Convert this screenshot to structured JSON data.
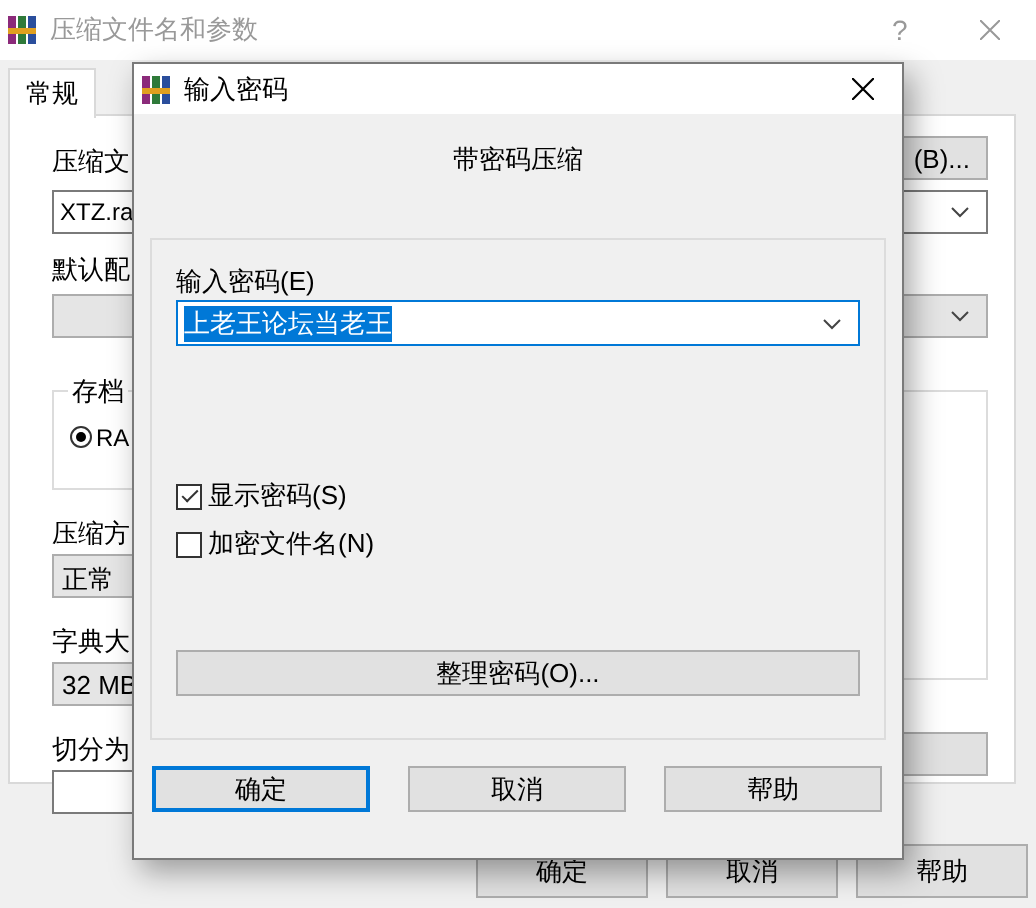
{
  "background_window": {
    "title": "压缩文件名和参数",
    "help_glyph": "?",
    "tabs": [
      {
        "label": "常规",
        "selected": true
      }
    ],
    "archive_name_label": "压缩文",
    "browse_button": "(B)...",
    "archive_name": "XTZ.ra",
    "profile_label": "默认配",
    "format_group": "存档",
    "format_option": {
      "label": "RA",
      "selected": true
    },
    "method_label": "压缩方",
    "method": "正常",
    "dictionary_label": "字典大",
    "dictionary": "32 MB",
    "split_label": "切分为",
    "buttons": [
      "确定",
      "取消",
      "帮助"
    ]
  },
  "dialog": {
    "title": "输入密码",
    "heading": "带密码压缩",
    "password_label": "输入密码(E)",
    "password": "上老王论坛当老王",
    "options": [
      {
        "label": "显示密码(S)",
        "checked": true
      },
      {
        "label": "加密文件名(N)",
        "checked": false
      }
    ],
    "organize_button": "整理密码(O)...",
    "buttons": [
      {
        "label": "确定",
        "default": true
      },
      {
        "label": "取消",
        "default": false
      },
      {
        "label": "帮助",
        "default": false
      }
    ]
  }
}
